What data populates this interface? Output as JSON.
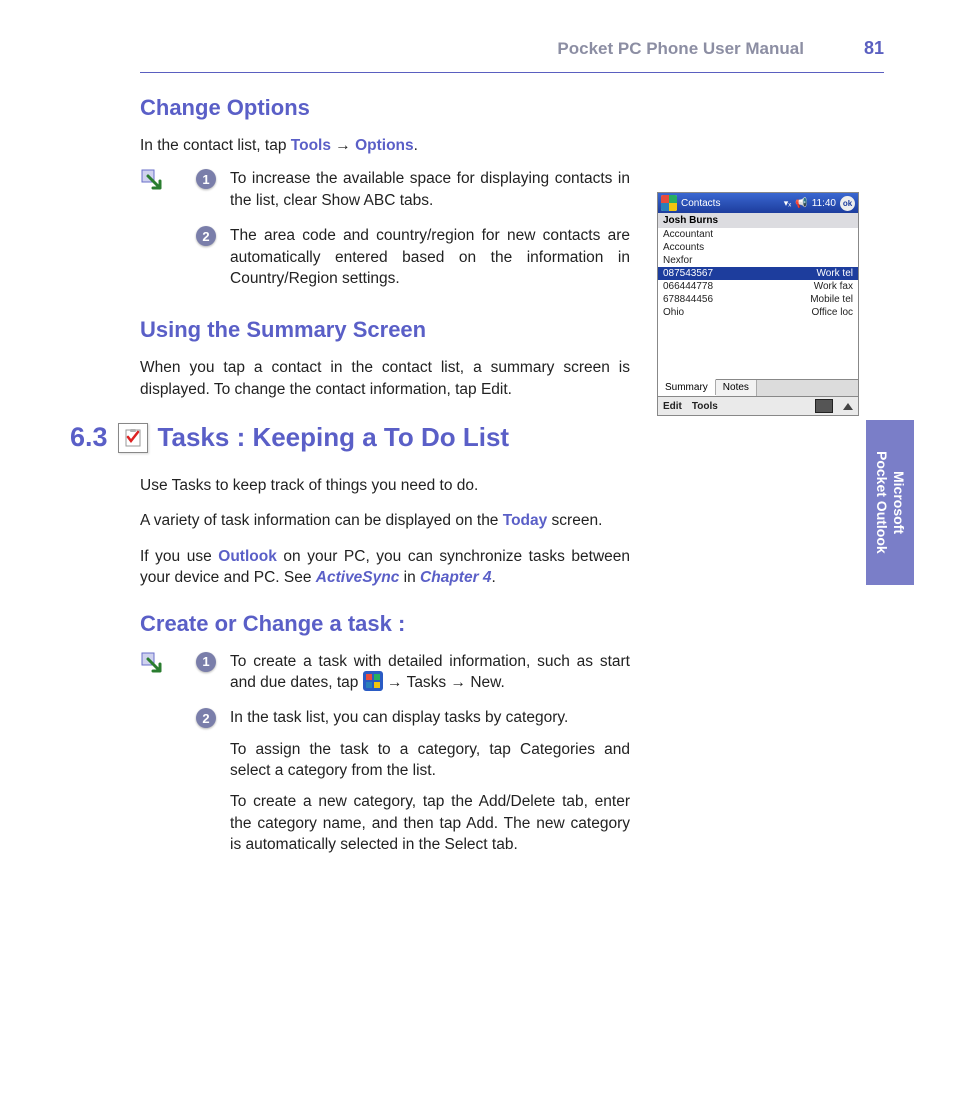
{
  "header": {
    "title": "Pocket PC Phone User Manual",
    "page": "81"
  },
  "sideTab": {
    "line1": "Microsoft",
    "line2": "Pocket Outlook"
  },
  "sections": {
    "changeOptions": {
      "heading": "Change Options",
      "intro_pre": "In the contact list, tap ",
      "tools": "Tools",
      "arrow": " → ",
      "options": "Options",
      "intro_post": ".",
      "item1_pre": "To increase the available space for displaying contacts in the list, clear ",
      "item1_kw": "Show ABC tabs",
      "item1_post": ".",
      "item2_pre": "The area code and country/region for new contacts are automatically entered based on the information in ",
      "item2_kw": "Country/Region settings",
      "item2_post": "."
    },
    "summary": {
      "heading": "Using the Summary Screen",
      "text_pre": "When you tap a contact in the contact list, a summary screen is displayed. To change the contact information, tap ",
      "text_kw": "Edit",
      "text_post": "."
    },
    "tasks": {
      "num": "6.3",
      "heading": "Tasks : Keeping a To Do List",
      "p1": "Use Tasks to keep track of things you need to do.",
      "p2_pre": "A variety of task information can be displayed on the ",
      "p2_kw": "Today",
      "p2_post": " screen.",
      "p3_a": "If you use ",
      "p3_kw1": "Outlook",
      "p3_b": " on your PC, you can synchronize tasks between your device and PC. See ",
      "p3_kw2": "ActiveSync",
      "p3_c": " in ",
      "p3_kw3": "Chapter 4",
      "p3_d": "."
    },
    "create": {
      "heading": "Create or Change a task :",
      "i1_a": "To create a task with detailed information, such as start and due dates, tap ",
      "i1_arrow1": " → ",
      "i1_kw1": "Tasks",
      "i1_arrow2": " → ",
      "i1_kw2": "New",
      "i1_end": ".",
      "i2_p1": "In the task list, you can display tasks by category.",
      "i2_p2_a": "To assign the task to a category, tap ",
      "i2_p2_kw": "Categories",
      "i2_p2_b": " and select a category from the list.",
      "i2_p3_a": "To create a new category, tap the ",
      "i2_p3_kw1": "Add/Delete",
      "i2_p3_b": " tab, enter the category name, and then tap ",
      "i2_p3_kw2": "Add",
      "i2_p3_c": ". The new category is automatically selected in the ",
      "i2_p3_kw3": "Select",
      "i2_p3_d": " tab."
    }
  },
  "screenshot": {
    "title": "Contacts",
    "time": "11:40",
    "ok": "ok",
    "name": "Josh Burns",
    "lines": [
      {
        "l": "Accountant",
        "r": ""
      },
      {
        "l": "Accounts",
        "r": ""
      },
      {
        "l": "Nexfor",
        "r": ""
      }
    ],
    "sel": {
      "l": "087543567",
      "r": "Work tel"
    },
    "rest": [
      {
        "l": "066444778",
        "r": "Work fax"
      },
      {
        "l": "678844456",
        "r": "Mobile tel"
      },
      {
        "l": "Ohio",
        "r": "Office loc"
      }
    ],
    "tab1": "Summary",
    "tab2": "Notes",
    "menu1": "Edit",
    "menu2": "Tools"
  }
}
